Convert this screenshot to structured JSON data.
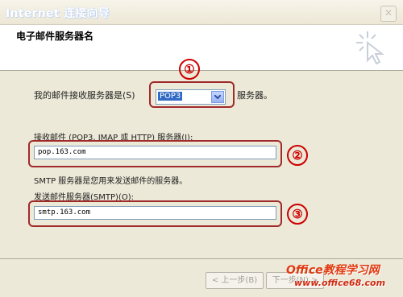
{
  "window": {
    "title": "Internet 连接向导"
  },
  "header": {
    "title": "电子邮件服务器名"
  },
  "form": {
    "incoming_type_prefix": "我的邮件接收服务器是(S)",
    "incoming_type_value": "POP3",
    "incoming_type_suffix": "服务器。",
    "incoming_server_label": "接收邮件 (POP3, IMAP 或 HTTP) 服务器(I):",
    "incoming_server_value": "pop.163.com",
    "smtp_description": "SMTP 服务器是您用来发送邮件的服务器。",
    "outgoing_server_label": "发送邮件服务器(SMTP)(O):",
    "outgoing_server_value": "smtp.163.com"
  },
  "annotations": {
    "one": "①",
    "two": "②",
    "three": "③"
  },
  "footer": {
    "back_label": "< 上一步(B)",
    "next_label": "下一步(N) >"
  },
  "watermark": {
    "brand": "Office教程学习网",
    "url": "www.office68.com"
  },
  "colors": {
    "annotation_red": "#cc0000",
    "highlight_blue": "#316ac5"
  }
}
